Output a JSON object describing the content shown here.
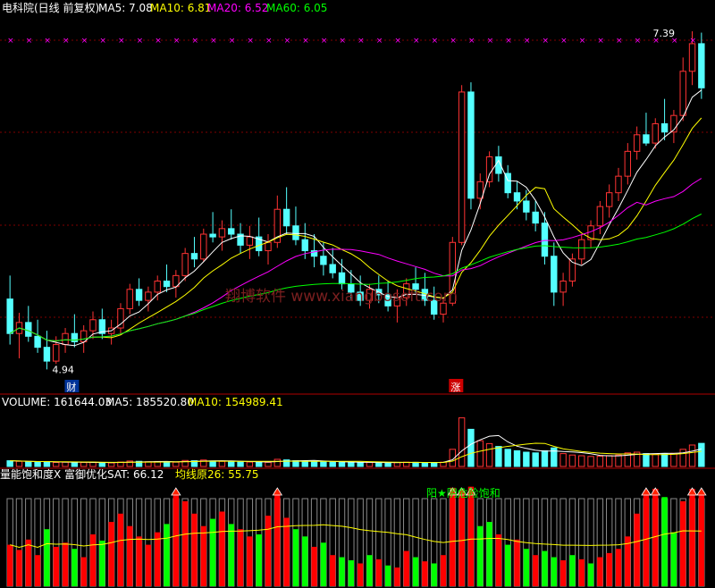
{
  "header": {
    "title": "电科院(日线 前复权)",
    "ma5": "MA5: 7.08",
    "ma10": "MA10: 6.81",
    "ma20": "MA20: 6.52",
    "ma60": "MA60: 6.05"
  },
  "price_panel": {
    "high_label": "7.39",
    "low_label": "4.94",
    "marker_cai": "财",
    "marker_zhang": "涨",
    "watermark": "翔博软件 www.xiangbosoft.com"
  },
  "volume_panel": {
    "volume": "VOLUME: 161644.03",
    "ma5": "MA5: 185520.80",
    "ma10": "MA10: 154989.41"
  },
  "indicator_panel": {
    "name": "量能饱和度X 富御优化SAT: 66.12",
    "avg": "均线原26: 55.75",
    "signal_text": "阳★阴危险饱和"
  },
  "colors": {
    "up": "#ff3333",
    "down": "#54ffff",
    "ma5": "#ffffff",
    "ma10": "#ffff00",
    "ma20": "#ff00ff",
    "ma60": "#00ff00",
    "grid": "#800000",
    "axis": "#b00000",
    "ind_up": "#ff0000",
    "ind_down": "#00ff00",
    "ind_line": "#ffff00"
  },
  "chart_data": [
    {
      "type": "candlestick",
      "title": "电科院(日线 前复权)",
      "ylim": [
        4.8,
        7.5
      ],
      "labels": {
        "high": 7.39,
        "low": 4.94
      },
      "ohlc": [
        [
          5.45,
          5.62,
          5.12,
          5.2
        ],
        [
          5.2,
          5.35,
          5.02,
          5.28
        ],
        [
          5.28,
          5.4,
          5.14,
          5.18
        ],
        [
          5.18,
          5.3,
          5.06,
          5.1
        ],
        [
          5.1,
          5.22,
          4.94,
          5.0
        ],
        [
          5.0,
          5.18,
          4.98,
          5.12
        ],
        [
          5.12,
          5.24,
          5.06,
          5.2
        ],
        [
          5.2,
          5.34,
          5.1,
          5.14
        ],
        [
          5.14,
          5.26,
          5.06,
          5.22
        ],
        [
          5.22,
          5.36,
          5.16,
          5.3
        ],
        [
          5.3,
          5.38,
          5.16,
          5.2
        ],
        [
          5.2,
          5.3,
          5.12,
          5.24
        ],
        [
          5.24,
          5.42,
          5.2,
          5.38
        ],
        [
          5.38,
          5.56,
          5.34,
          5.52
        ],
        [
          5.52,
          5.6,
          5.4,
          5.44
        ],
        [
          5.44,
          5.54,
          5.36,
          5.5
        ],
        [
          5.5,
          5.62,
          5.44,
          5.58
        ],
        [
          5.58,
          5.7,
          5.5,
          5.54
        ],
        [
          5.54,
          5.66,
          5.46,
          5.62
        ],
        [
          5.62,
          5.82,
          5.58,
          5.78
        ],
        [
          5.78,
          5.9,
          5.68,
          5.74
        ],
        [
          5.74,
          5.96,
          5.72,
          5.92
        ],
        [
          5.92,
          6.08,
          5.86,
          5.9
        ],
        [
          5.9,
          6.02,
          5.8,
          5.96
        ],
        [
          5.96,
          6.1,
          5.88,
          5.92
        ],
        [
          5.92,
          6.0,
          5.78,
          5.84
        ],
        [
          5.84,
          5.98,
          5.74,
          5.9
        ],
        [
          5.9,
          6.04,
          5.76,
          5.8
        ],
        [
          5.8,
          5.92,
          5.7,
          5.86
        ],
        [
          5.86,
          6.2,
          5.82,
          6.1
        ],
        [
          6.1,
          6.26,
          5.92,
          5.98
        ],
        [
          5.98,
          6.12,
          5.84,
          5.88
        ],
        [
          5.88,
          6.0,
          5.74,
          5.8
        ],
        [
          5.8,
          5.92,
          5.68,
          5.76
        ],
        [
          5.76,
          5.86,
          5.62,
          5.7
        ],
        [
          5.7,
          5.82,
          5.6,
          5.64
        ],
        [
          5.64,
          5.74,
          5.52,
          5.56
        ],
        [
          5.56,
          5.66,
          5.44,
          5.5
        ],
        [
          5.5,
          5.62,
          5.4,
          5.44
        ],
        [
          5.44,
          5.56,
          5.38,
          5.52
        ],
        [
          5.52,
          5.62,
          5.42,
          5.48
        ],
        [
          5.48,
          5.58,
          5.36,
          5.4
        ],
        [
          5.4,
          5.52,
          5.28,
          5.46
        ],
        [
          5.46,
          5.6,
          5.4,
          5.56
        ],
        [
          5.56,
          5.68,
          5.48,
          5.52
        ],
        [
          5.52,
          5.64,
          5.4,
          5.44
        ],
        [
          5.44,
          5.54,
          5.3,
          5.34
        ],
        [
          5.34,
          5.46,
          5.28,
          5.42
        ],
        [
          5.42,
          5.9,
          5.4,
          5.86
        ],
        [
          5.86,
          7.0,
          5.84,
          6.95
        ],
        [
          6.95,
          7.02,
          6.1,
          6.18
        ],
        [
          6.18,
          6.36,
          6.1,
          6.3
        ],
        [
          6.3,
          6.52,
          6.26,
          6.48
        ],
        [
          6.48,
          6.56,
          6.3,
          6.36
        ],
        [
          6.36,
          6.42,
          6.18,
          6.22
        ],
        [
          6.22,
          6.3,
          6.1,
          6.16
        ],
        [
          6.16,
          6.24,
          6.02,
          6.08
        ],
        [
          6.08,
          6.16,
          5.94,
          6.0
        ],
        [
          6.0,
          6.08,
          5.7,
          5.76
        ],
        [
          5.76,
          5.86,
          5.4,
          5.5
        ],
        [
          5.5,
          5.64,
          5.4,
          5.58
        ],
        [
          5.58,
          5.78,
          5.54,
          5.74
        ],
        [
          5.74,
          5.92,
          5.7,
          5.88
        ],
        [
          5.88,
          6.02,
          5.82,
          5.98
        ],
        [
          5.98,
          6.16,
          5.92,
          6.12
        ],
        [
          6.12,
          6.28,
          6.04,
          6.22
        ],
        [
          6.22,
          6.4,
          6.16,
          6.34
        ],
        [
          6.34,
          6.58,
          6.28,
          6.52
        ],
        [
          6.52,
          6.7,
          6.46,
          6.64
        ],
        [
          6.64,
          6.8,
          6.56,
          6.58
        ],
        [
          6.58,
          6.76,
          6.54,
          6.72
        ],
        [
          6.72,
          6.9,
          6.6,
          6.66
        ],
        [
          6.66,
          6.82,
          6.58,
          6.78
        ],
        [
          6.78,
          7.2,
          6.74,
          7.1
        ],
        [
          7.1,
          7.39,
          7.0,
          7.3
        ],
        [
          7.3,
          7.38,
          6.9,
          6.98
        ]
      ]
    },
    {
      "type": "bar",
      "title": "VOLUME",
      "ylim": [
        0,
        400000
      ],
      "values": [
        40000,
        36000,
        32000,
        30000,
        34000,
        28000,
        30000,
        26000,
        28000,
        30000,
        27000,
        25000,
        31000,
        38000,
        36000,
        33000,
        35000,
        32000,
        30000,
        42000,
        40000,
        45000,
        38000,
        36000,
        34000,
        32000,
        31000,
        30000,
        29000,
        50000,
        46000,
        40000,
        37000,
        35000,
        33000,
        31000,
        30000,
        28000,
        27000,
        29000,
        28000,
        26000,
        27000,
        30000,
        29000,
        28000,
        26000,
        30000,
        120000,
        340000,
        260000,
        180000,
        160000,
        140000,
        120000,
        110000,
        100000,
        95000,
        110000,
        130000,
        90000,
        80000,
        75000,
        70000,
        72000,
        76000,
        80000,
        95000,
        100000,
        90000,
        85000,
        88000,
        92000,
        120000,
        150000,
        161644
      ]
    },
    {
      "type": "bar",
      "title": "量能饱和度X 富御优化SAT",
      "ylim": [
        0,
        100
      ],
      "values": [
        40,
        35,
        45,
        30,
        55,
        38,
        42,
        36,
        28,
        50,
        44,
        62,
        70,
        58,
        48,
        40,
        52,
        60,
        88,
        82,
        70,
        58,
        65,
        72,
        60,
        55,
        48,
        50,
        68,
        92,
        66,
        55,
        48,
        38,
        42,
        30,
        28,
        25,
        22,
        30,
        26,
        20,
        18,
        34,
        28,
        24,
        22,
        30,
        95,
        92,
        96,
        58,
        62,
        50,
        40,
        45,
        36,
        30,
        34,
        28,
        25,
        30,
        26,
        22,
        28,
        32,
        36,
        48,
        70,
        92,
        94,
        86,
        52,
        82,
        94,
        90
      ],
      "up": [
        true,
        true,
        true,
        true,
        false,
        true,
        true,
        false,
        true,
        true,
        false,
        true,
        true,
        true,
        true,
        true,
        true,
        false,
        true,
        true,
        true,
        true,
        false,
        true,
        false,
        true,
        true,
        false,
        true,
        true,
        true,
        false,
        false,
        true,
        false,
        true,
        false,
        false,
        true,
        false,
        true,
        false,
        true,
        true,
        false,
        true,
        false,
        true,
        true,
        true,
        true,
        false,
        false,
        true,
        false,
        true,
        false,
        true,
        false,
        false,
        true,
        false,
        true,
        false,
        true,
        true,
        true,
        true,
        true,
        true,
        true,
        false,
        false,
        true,
        true,
        true
      ]
    }
  ]
}
